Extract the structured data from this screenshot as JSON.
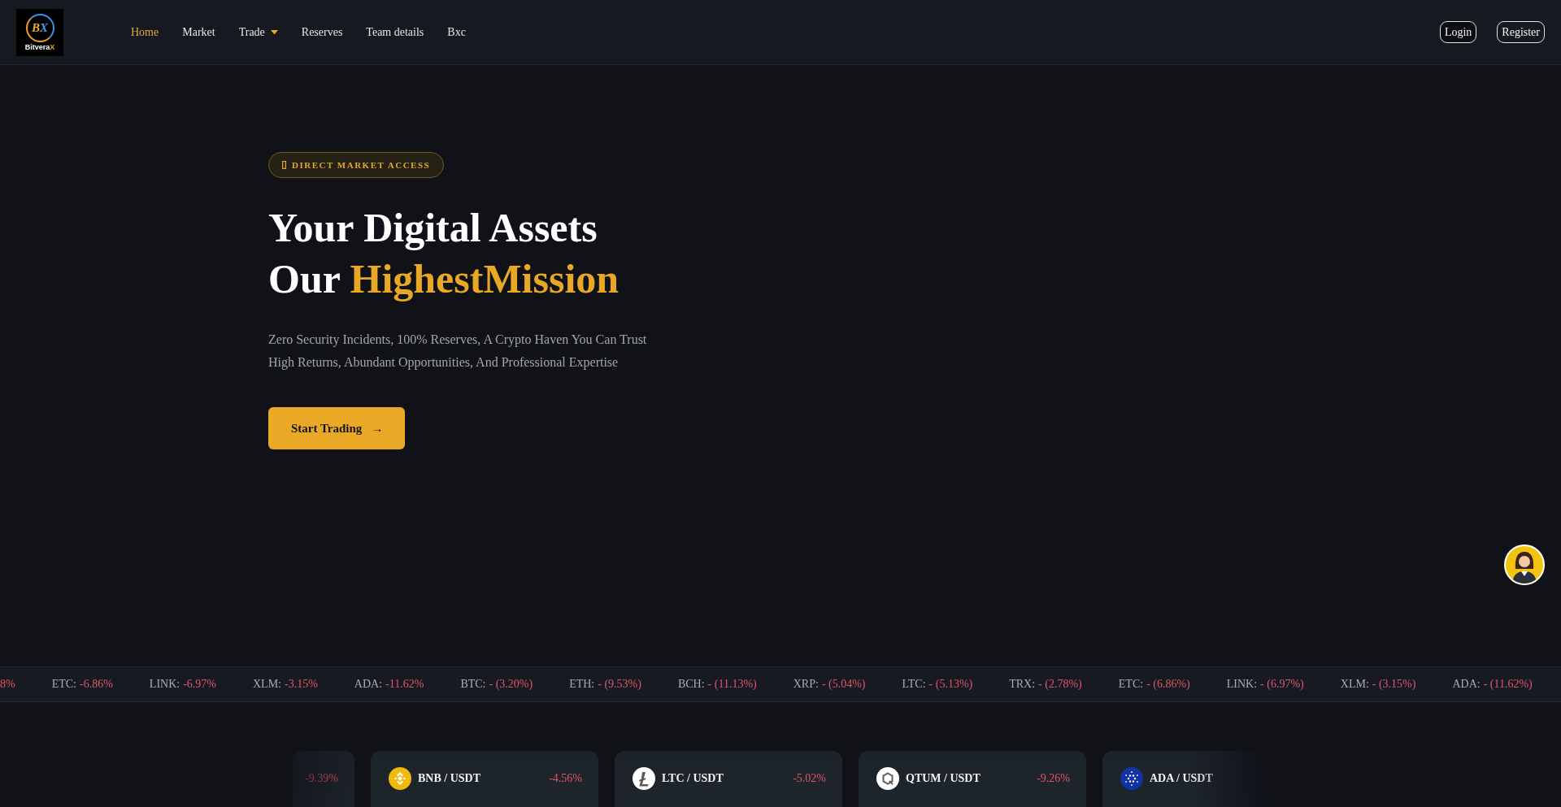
{
  "header": {
    "logo": {
      "emblem": "BX",
      "wordmark": "Bitvera",
      "wordmark_accent": "X"
    },
    "nav": [
      {
        "label": "Home",
        "selected": true,
        "kind": "link"
      },
      {
        "label": "Market",
        "selected": false,
        "kind": "link"
      },
      {
        "label": "Trade",
        "selected": false,
        "kind": "dropdown"
      },
      {
        "label": "Reserves",
        "selected": false,
        "kind": "link"
      },
      {
        "label": "Team details",
        "selected": false,
        "kind": "link"
      },
      {
        "label": "Bxc",
        "selected": false,
        "kind": "link"
      }
    ],
    "buttons": [
      {
        "label": "Login",
        "kind": "solid"
      },
      {
        "label": "Register",
        "kind": "outline"
      }
    ]
  },
  "hero": {
    "badge": "DIRECT MARKET ACCESS",
    "title": {
      "line_1": "Your Digital Assets",
      "line_2": "Our",
      "highlight": "HighestMission"
    },
    "text": [
      "Zero Security Incidents, 100% Reserves, A Crypto Haven You Can Trust",
      "High Returns, Abundant Opportunities, And Professional Expertise"
    ],
    "button": {
      "label": "Start Trading",
      "arrow": "→"
    }
  },
  "ticker": [
    {
      "value": "8%"
    },
    {
      "label": "ETC:",
      "value": "-6.86%"
    },
    {
      "label": "LINK:",
      "value": "-6.97%"
    },
    {
      "label": "XLM:",
      "value": "-3.15%"
    },
    {
      "label": "ADA:",
      "value": "-11.62%"
    },
    {
      "label": "BTC:",
      "value": "- (3.20%)"
    },
    {
      "label": "ETH:",
      "value": "- (9.53%)"
    },
    {
      "label": "BCH:",
      "value": "- (11.13%)"
    },
    {
      "label": "XRP:",
      "value": "- (5.04%)"
    },
    {
      "label": "LTC:",
      "value": "- (5.13%)"
    },
    {
      "label": "TRX:",
      "value": "- (2.78%)"
    },
    {
      "label": "ETC:",
      "value": "- (6.86%)"
    },
    {
      "label": "LINK:",
      "value": "- (6.97%)"
    },
    {
      "label": "XLM:",
      "value": "- (3.15%)"
    },
    {
      "label": "ADA:",
      "value": "- (11.62%)"
    }
  ],
  "market_cards": [
    {
      "change": "-9.39%"
    },
    {
      "pair": "BNB / USDT",
      "change": "-4.56%",
      "color": "#f0b90b"
    },
    {
      "pair": "LTC / USDT",
      "change": "-5.02%",
      "color": "#ffffff"
    },
    {
      "pair": "QTUM / USDT",
      "change": "-9.26%",
      "color": "#ffffff"
    },
    {
      "pair": "ADA / USDT",
      "color": "#1133a6"
    }
  ]
}
